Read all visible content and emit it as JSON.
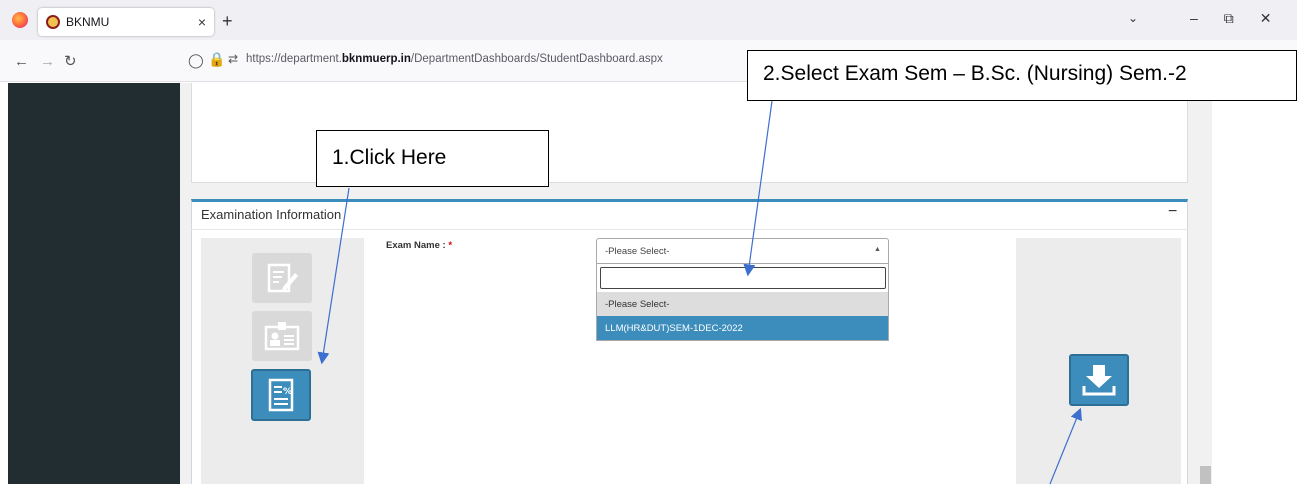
{
  "browser": {
    "tab_title": "BKNMU",
    "tab_close": "×",
    "new_tab": "+",
    "url_prefix": "https://department.",
    "url_domain": "bknmuerp.in",
    "url_path": "/DepartmentDashboards/StudentDashboard.aspx"
  },
  "exam_section": {
    "title": "Examination Information",
    "collapse": "−",
    "exam_name_label": "Exam Name :",
    "required_mark": "*",
    "select_value": "-Please Select-",
    "search_value": "",
    "options": [
      "-Please Select-",
      "LLM(HR&DUT)SEM-1DEC-2022"
    ]
  },
  "annotations": {
    "step1": "1.Click Here",
    "step2": "2.Select Exam Sem –   B.Sc. (Nursing) Sem.-2"
  },
  "colors": {
    "accent": "#3c8dbc",
    "sidebar": "#222d32"
  }
}
